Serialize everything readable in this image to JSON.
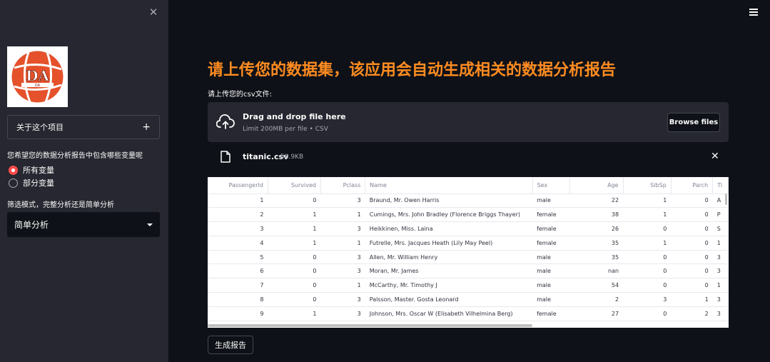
{
  "sidebar": {
    "logo_text": "DA",
    "expander_label": "关于这个项目",
    "expander_icon": "plus-icon",
    "variables_question": "您希望您的数据分析报告中包含哪些变量呢",
    "radio_options": [
      "所有变量",
      "部分变量"
    ],
    "mode_question": "筛选模式，完整分析还是简单分析",
    "mode_selected": "简单分析"
  },
  "main": {
    "title": "请上传您的数据集，该应用会自动生成相关的数据分析报告",
    "upload_label": "请上传您的csv文件:",
    "dropzone_title": "Drag and drop file here",
    "dropzone_limit": "Limit 200MB per file • CSV",
    "browse_label": "Browse files",
    "file_name": "titanic.csv",
    "file_size": "58.9KB",
    "generate_label": "生成报告"
  },
  "table": {
    "columns": [
      "PassengerId",
      "Survived",
      "Pclass",
      "Name",
      "Sex",
      "Age",
      "SibSp",
      "Parch",
      "Ti"
    ],
    "rows": [
      [
        "1",
        "0",
        "3",
        "Braund, Mr. Owen Harris",
        "male",
        "22",
        "1",
        "0",
        "A"
      ],
      [
        "2",
        "1",
        "1",
        "Cumings, Mrs. John Bradley (Florence Briggs Thayer)",
        "female",
        "38",
        "1",
        "0",
        "P"
      ],
      [
        "3",
        "1",
        "3",
        "Heikkinen, Miss. Laina",
        "female",
        "26",
        "0",
        "0",
        "S"
      ],
      [
        "4",
        "1",
        "1",
        "Futrelle, Mrs. Jacques Heath (Lily May Peel)",
        "female",
        "35",
        "1",
        "0",
        "1"
      ],
      [
        "5",
        "0",
        "3",
        "Allen, Mr. William Henry",
        "male",
        "35",
        "0",
        "0",
        "3"
      ],
      [
        "6",
        "0",
        "3",
        "Moran, Mr. James",
        "male",
        "nan",
        "0",
        "0",
        "3"
      ],
      [
        "7",
        "0",
        "1",
        "McCarthy, Mr. Timothy J",
        "male",
        "54",
        "0",
        "0",
        "1"
      ],
      [
        "8",
        "0",
        "3",
        "Palsson, Master. Gosta Leonard",
        "male",
        "2",
        "3",
        "1",
        "3"
      ],
      [
        "9",
        "1",
        "3",
        "Johnson, Mrs. Oscar W (Elisabeth Vilhelmina Berg)",
        "female",
        "27",
        "0",
        "2",
        "3"
      ]
    ]
  },
  "colors": {
    "accent": "#ff4b4b",
    "title": "#ff8c21",
    "background": "#0e1117",
    "sidebar": "#262730"
  }
}
